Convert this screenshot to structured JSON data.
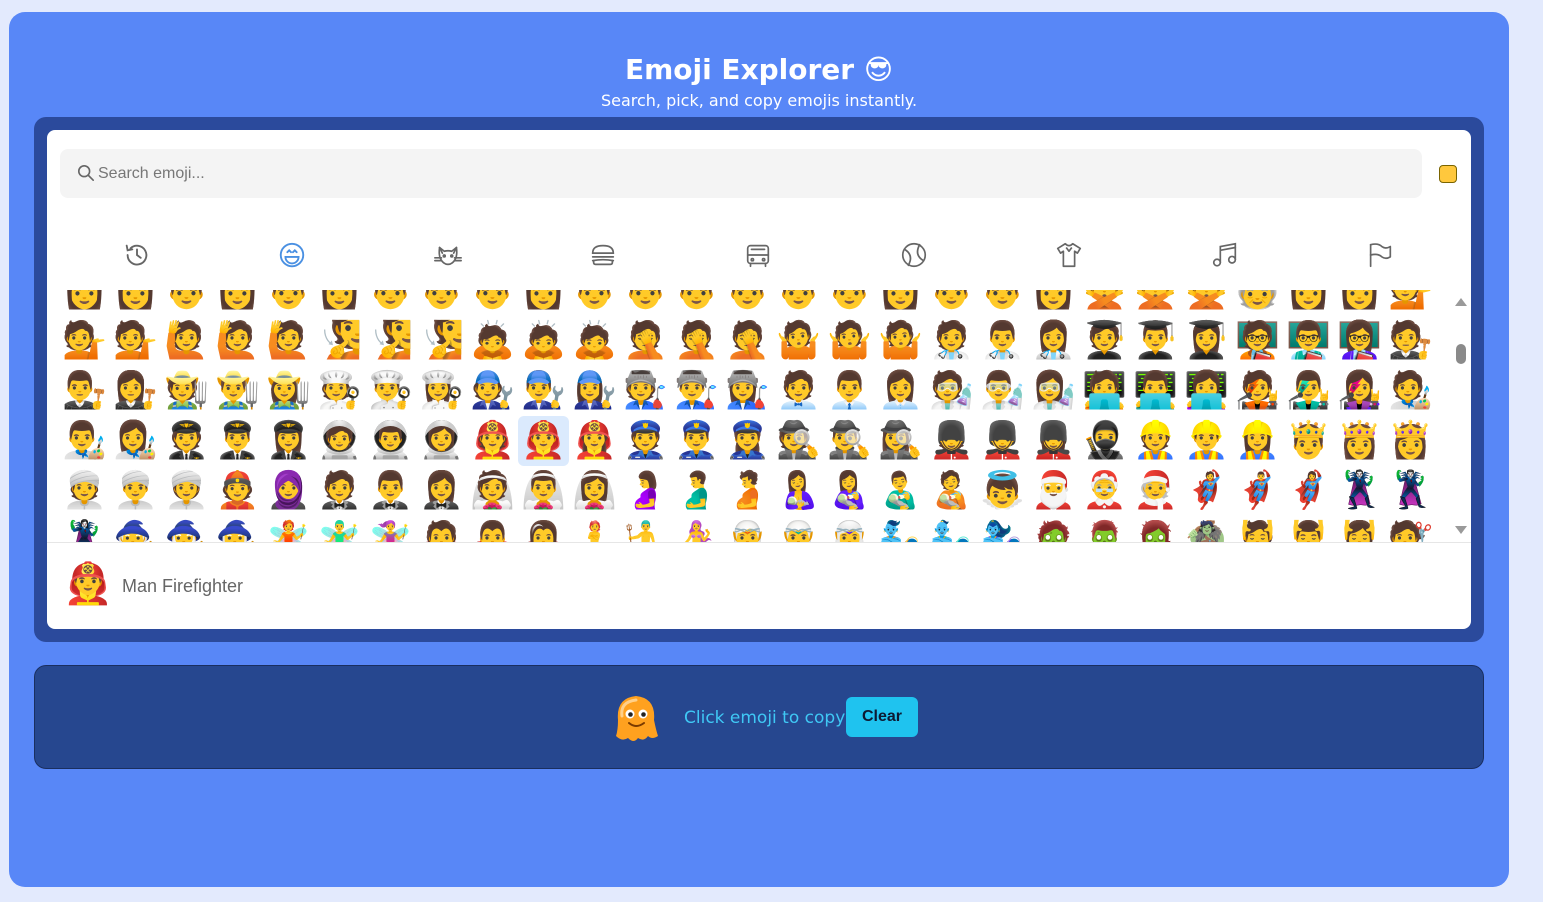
{
  "header": {
    "title": "Emoji Explorer 😎",
    "subtitle": "Search, pick, and copy emojis instantly."
  },
  "search": {
    "placeholder": "Search emoji...",
    "value": ""
  },
  "skin_tone": {
    "color": "#ffc83d"
  },
  "categories": [
    {
      "name": "recent-icon",
      "active": false
    },
    {
      "name": "smileys-icon",
      "active": true
    },
    {
      "name": "animals-icon",
      "active": false
    },
    {
      "name": "food-icon",
      "active": false
    },
    {
      "name": "travel-icon",
      "active": false
    },
    {
      "name": "activity-icon",
      "active": false
    },
    {
      "name": "objects-icon",
      "active": false
    },
    {
      "name": "symbols-icon",
      "active": false
    },
    {
      "name": "flags-icon",
      "active": false
    }
  ],
  "emoji_rows": [
    [
      "👩",
      "👩",
      "👨",
      "👩",
      "👨",
      "👩",
      "👨",
      "👨",
      "👨",
      "👩",
      "👨",
      "👨",
      "👨",
      "👨",
      "👨",
      "👨",
      "👩",
      "👨",
      "👨",
      "👩",
      "🙅",
      "🙅",
      "🙅",
      "🧓",
      "👩",
      "👩",
      "💁"
    ],
    [
      "💁",
      "💁",
      "🙋",
      "🙋",
      "🙋",
      "🧏",
      "🧏",
      "🧏",
      "🙇",
      "🙇",
      "🙇",
      "🤦",
      "🤦",
      "🤦",
      "🤷",
      "🤷",
      "🤷",
      "🧑‍⚕️",
      "👨‍⚕️",
      "👩‍⚕️",
      "🧑‍🎓",
      "👨‍🎓",
      "👩‍🎓",
      "🧑‍🏫",
      "👨‍🏫",
      "👩‍🏫",
      "🧑‍⚖️"
    ],
    [
      "👨‍⚖️",
      "👩‍⚖️",
      "🧑‍🌾",
      "👨‍🌾",
      "👩‍🌾",
      "🧑‍🍳",
      "👨‍🍳",
      "👩‍🍳",
      "🧑‍🔧",
      "👨‍🔧",
      "👩‍🔧",
      "🧑‍🏭",
      "👨‍🏭",
      "👩‍🏭",
      "🧑‍💼",
      "👨‍💼",
      "👩‍💼",
      "🧑‍🔬",
      "👨‍🔬",
      "👩‍🔬",
      "🧑‍💻",
      "👨‍💻",
      "👩‍💻",
      "🧑‍🎤",
      "👨‍🎤",
      "👩‍🎤",
      "🧑‍🎨"
    ],
    [
      "👨‍🎨",
      "👩‍🎨",
      "🧑‍✈️",
      "👨‍✈️",
      "👩‍✈️",
      "🧑‍🚀",
      "👨‍🚀",
      "👩‍🚀",
      "🧑‍🚒",
      "👨‍🚒",
      "👩‍🚒",
      "👮",
      "👮‍♂️",
      "👮‍♀️",
      "🕵️",
      "🕵️‍♂️",
      "🕵️‍♀️",
      "💂",
      "💂‍♂️",
      "💂‍♀️",
      "🥷",
      "👷",
      "👷‍♂️",
      "👷‍♀️",
      "🤴",
      "👸",
      "👸"
    ],
    [
      "👳",
      "👳‍♂️",
      "👳‍♀️",
      "👲",
      "🧕",
      "🤵",
      "🤵‍♂️",
      "🤵‍♀️",
      "👰",
      "👰‍♂️",
      "👰‍♀️",
      "🤰",
      "🫃",
      "🫄",
      "🤱",
      "👩‍🍼",
      "👨‍🍼",
      "🧑‍🍼",
      "👼",
      "🎅",
      "🤶",
      "🧑‍🎄",
      "🦸",
      "🦸‍♂️",
      "🦸‍♀️",
      "🦹",
      "🦹‍♂️"
    ],
    [
      "🦹‍♀️",
      "🧙",
      "🧙‍♂️",
      "🧙‍♀️",
      "🧚",
      "🧚‍♂️",
      "🧚‍♀️",
      "🧛",
      "🧛‍♂️",
      "🧛‍♀️",
      "🧜",
      "🧜‍♂️",
      "🧜‍♀️",
      "🧝",
      "🧝‍♂️",
      "🧝‍♀️",
      "🧞",
      "🧞‍♂️",
      "🧞‍♀️",
      "🧟",
      "🧟‍♂️",
      "🧟‍♀️",
      "🧌",
      "💆",
      "💆‍♂️",
      "💆‍♀️",
      "💇"
    ]
  ],
  "selected": {
    "row": 3,
    "col": 9
  },
  "preview": {
    "emoji": "👨‍🚒",
    "name": "Man Firefighter"
  },
  "copy_bar": {
    "hint": "Click emoji to copy",
    "clear_label": "Clear"
  },
  "colors": {
    "background": "#5887f7",
    "frame": "#2b4a9c",
    "copy_bar": "#26478f",
    "accent": "#1fc3ef",
    "active_category": "#4a90e2"
  }
}
